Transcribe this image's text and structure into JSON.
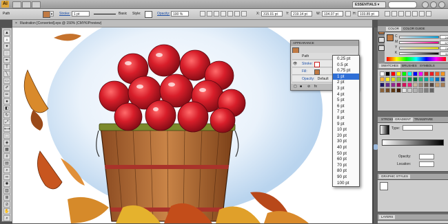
{
  "appbar": {
    "logo": "Ai",
    "workspace": "ESSENTIALS ▾"
  },
  "control_bar": {
    "object_label": "Path",
    "fill_color": "#c07a43",
    "stroke_label": "Stroke:",
    "stroke_value": "1 pt",
    "brush_label": "Basic",
    "style_label": "Style:",
    "opacity_label": "Opacity:",
    "opacity_value": "100 %",
    "x_label": "X:",
    "x_value": "315.01 pt",
    "y_label": "Y:",
    "y_value": "219.14 pt",
    "w_label": "W:",
    "w_value": "104.07 pt",
    "h_label": "H:",
    "h_value": "103.85 pt"
  },
  "document": {
    "tab_title": "Illustration [Converted].eps @ 150% (CMYK/Preview)"
  },
  "appearance_panel": {
    "title": "APPEARANCE",
    "object": "Path",
    "stroke_row": "Stroke:",
    "fill_row": "Fill:",
    "opacity_row": "Opacity:",
    "opacity_value": "Default"
  },
  "stroke_menu": {
    "options": [
      "0.25 pt",
      "0.5 pt",
      "0.75 pt",
      "1 pt",
      "2 pt",
      "3 pt",
      "4 pt",
      "5 pt",
      "6 pt",
      "7 pt",
      "8 pt",
      "9 pt",
      "10 pt",
      "20 pt",
      "30 pt",
      "40 pt",
      "50 pt",
      "60 pt",
      "70 pt",
      "80 pt",
      "90 pt",
      "100 pt"
    ],
    "selected": "1 pt"
  },
  "dock": {
    "color_tab": "COLOR",
    "color_guide_tab": "COLOR GUIDE",
    "c_label": "C",
    "m_label": "M",
    "y_label": "Y",
    "k_label": "K",
    "c_value": "24",
    "m_value": "57",
    "y_value": "79",
    "k_value": "11",
    "swatches_tab": "SWATCHES",
    "brushes_tab": "BRUSHES",
    "symbols_tab": "SYMBOLS",
    "stroke_tab": "STROKE",
    "gradient_tab": "GRADIENT",
    "transparency_tab": "TRANSPARE",
    "type_label": "Type:",
    "opacity_label": "Opacity:",
    "location_label": "Location:",
    "graphic_styles_tab": "GRAPHIC STYLES",
    "layers_tab": "LAYERS",
    "swatch_colors": [
      "#ffffff",
      "#000000",
      "#ff0000",
      "#ffff00",
      "#00ff00",
      "#00ffff",
      "#0000ff",
      "#ff00ff",
      "#c1272d",
      "#ed1c24",
      "#f15a24",
      "#f7931e",
      "#fbb03b",
      "#fcee21",
      "#d9e021",
      "#8cc63f",
      "#39b54a",
      "#009245",
      "#006837",
      "#22b573",
      "#00a99d",
      "#29abe2",
      "#0071bc",
      "#2e3192",
      "#1b1464",
      "#662d91",
      "#93278f",
      "#9e005d",
      "#d4145a",
      "#ed1e79",
      "#c7b299",
      "#998675",
      "#736357",
      "#534741",
      "#c69c6d",
      "#a67c52",
      "#8c6239",
      "#754c24",
      "#603813",
      "#42210b",
      "#e6e6e6",
      "#cccccc",
      "#b3b3b3",
      "#999999",
      "#808080",
      "#666666"
    ]
  }
}
